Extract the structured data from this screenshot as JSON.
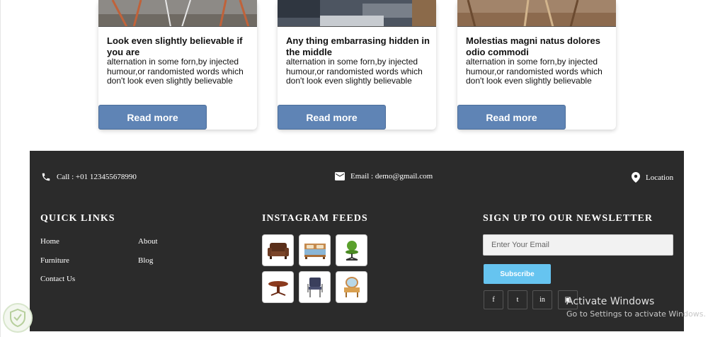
{
  "cards": [
    {
      "title": "Look even slightly believable if you are",
      "description": "alternation in some forn,by injected humour,or randomisted words which don't look even slightly believable",
      "button_label": "Read more"
    },
    {
      "title": "Any thing embarrasing hidden in the middle",
      "description": "alternation in some forn,by injected humour,or randomisted words which don't look even slightly believable",
      "button_label": "Read more"
    },
    {
      "title": "Molestias magni natus dolores odio commodi",
      "description": "alternation in some forn,by injected humour,or randomisted words which don't look even slightly believable",
      "button_label": "Read more"
    }
  ],
  "footer": {
    "contact": {
      "phone": "Call : +01 123455678990",
      "email": "Email : demo@gmail.com",
      "location": "Location"
    },
    "quick_links": {
      "heading": "QUICK LINKS",
      "items": [
        "Home",
        "About",
        "Furniture",
        "Blog",
        "Contact Us"
      ]
    },
    "instagram": {
      "heading": "INSTAGRAM FEEDS",
      "items": [
        "armchair",
        "bed",
        "office-chair",
        "round-table",
        "chair",
        "dressing-table"
      ]
    },
    "newsletter": {
      "heading": "SIGN UP TO OUR NEWSLETTER",
      "placeholder": "Enter Your Email",
      "button_label": "Subscribe",
      "social": [
        "f",
        "t",
        "in",
        "▣"
      ]
    }
  },
  "watermark": {
    "line1": "Activate Windows",
    "line2": "Go to Settings to activate Windows."
  },
  "colors": {
    "button": "#5f84b5",
    "footer_bg": "#2b2b2b",
    "subscribe": "#66c4f0"
  }
}
